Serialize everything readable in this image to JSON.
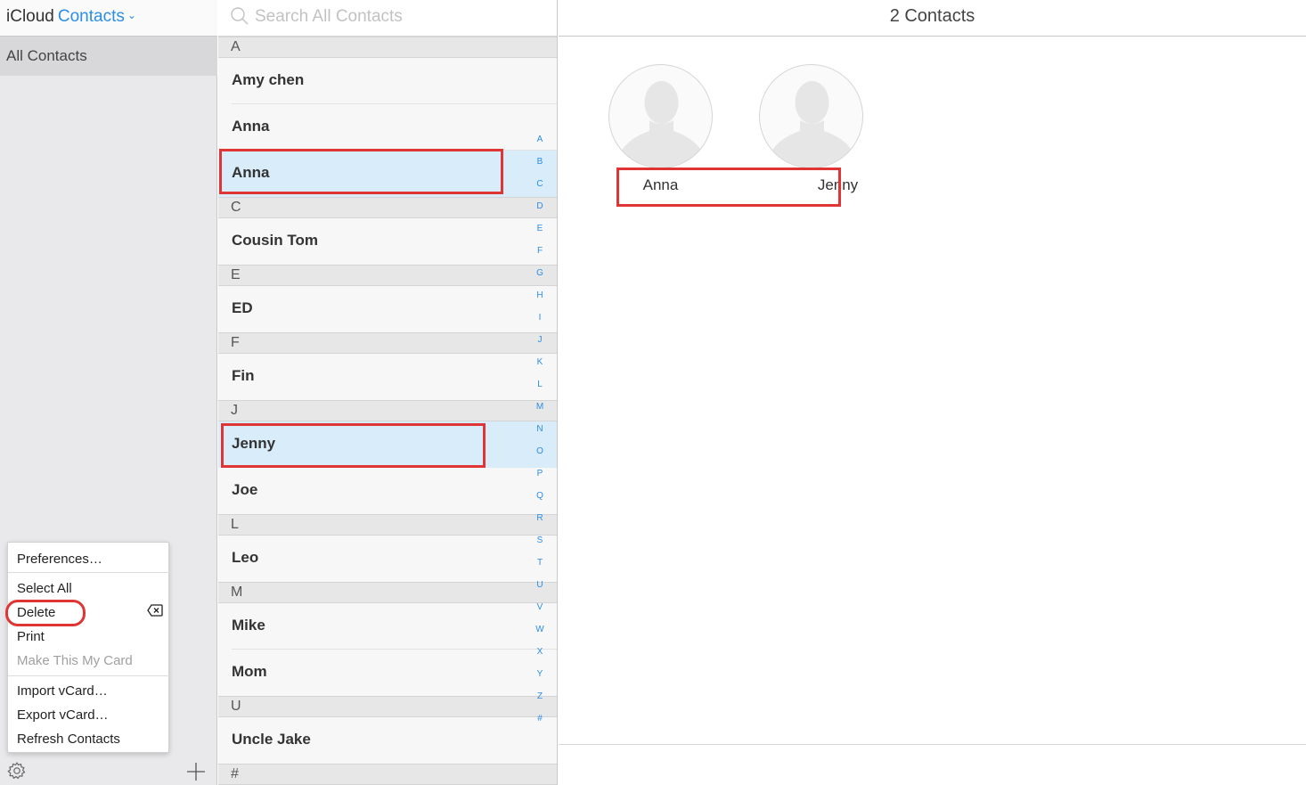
{
  "brand": {
    "prefix": "iCloud",
    "app": "Contacts"
  },
  "sidebar": {
    "group": "All Contacts"
  },
  "menu": {
    "preferences": "Preferences…",
    "select_all": "Select All",
    "delete": "Delete",
    "print": "Print",
    "make_my_card": "Make This My Card",
    "import_vcard": "Import vCard…",
    "export_vcard": "Export vCard…",
    "refresh": "Refresh Contacts"
  },
  "search": {
    "placeholder": "Search All Contacts"
  },
  "list": {
    "sections": [
      {
        "letter": "A",
        "contacts": [
          "Amy chen",
          "Anna",
          "Anna"
        ]
      },
      {
        "letter": "C",
        "contacts": [
          "Cousin Tom"
        ]
      },
      {
        "letter": "E",
        "contacts": [
          "ED"
        ]
      },
      {
        "letter": "F",
        "contacts": [
          "Fin"
        ]
      },
      {
        "letter": "J",
        "contacts": [
          "Jenny",
          "Joe"
        ]
      },
      {
        "letter": "L",
        "contacts": [
          "Leo"
        ]
      },
      {
        "letter": "M",
        "contacts": [
          "Mike",
          "Mom"
        ]
      },
      {
        "letter": "U",
        "contacts": [
          "Uncle Jake"
        ]
      },
      {
        "letter": "#",
        "contacts": []
      }
    ],
    "selected": [
      "Anna",
      "Jenny"
    ]
  },
  "alphabet": [
    "A",
    "B",
    "C",
    "D",
    "E",
    "F",
    "G",
    "H",
    "I",
    "J",
    "K",
    "L",
    "M",
    "N",
    "O",
    "P",
    "Q",
    "R",
    "S",
    "T",
    "U",
    "V",
    "W",
    "X",
    "Y",
    "Z",
    "#"
  ],
  "main": {
    "title": "2 Contacts",
    "cards": [
      {
        "name": "Anna"
      },
      {
        "name": "Jenny"
      }
    ]
  },
  "colors": {
    "accent": "#2b8de6",
    "selection": "#d9ecf9",
    "highlight": "#e03535"
  }
}
